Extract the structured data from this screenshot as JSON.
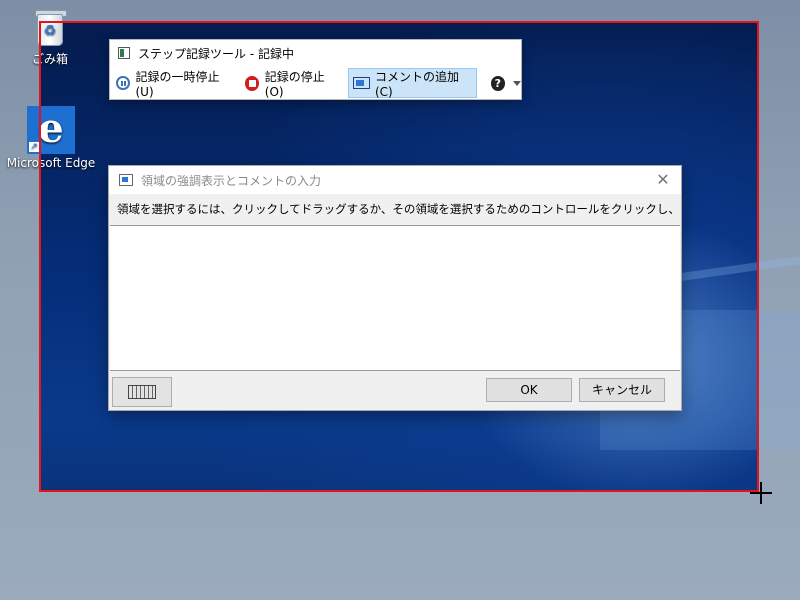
{
  "desktop": {
    "icons": [
      {
        "label": "ごみ箱",
        "icon": "recycle-bin-icon"
      },
      {
        "label": "Microsoft Edge",
        "icon": "edge-icon"
      }
    ]
  },
  "recorder": {
    "title": "ステップ記録ツール - 記録中",
    "pause_label": "記録の一時停止(U)",
    "stop_label": "記録の停止(O)",
    "comment_label": "コメントの追加(C)",
    "help_glyph": "?"
  },
  "dialog": {
    "title": "領域の強調表示とコメントの入力",
    "close_glyph": "✕",
    "instruction": "領域を選択するには、クリックしてドラッグするか、その領域を選択するためのコントロールをクリックし、コメントを入力します:",
    "comment_value": "",
    "ok_label": "OK",
    "cancel_label": "キャンセル"
  },
  "colors": {
    "selection_border": "#e8121b",
    "edge_brand": "#1d6fd1"
  }
}
